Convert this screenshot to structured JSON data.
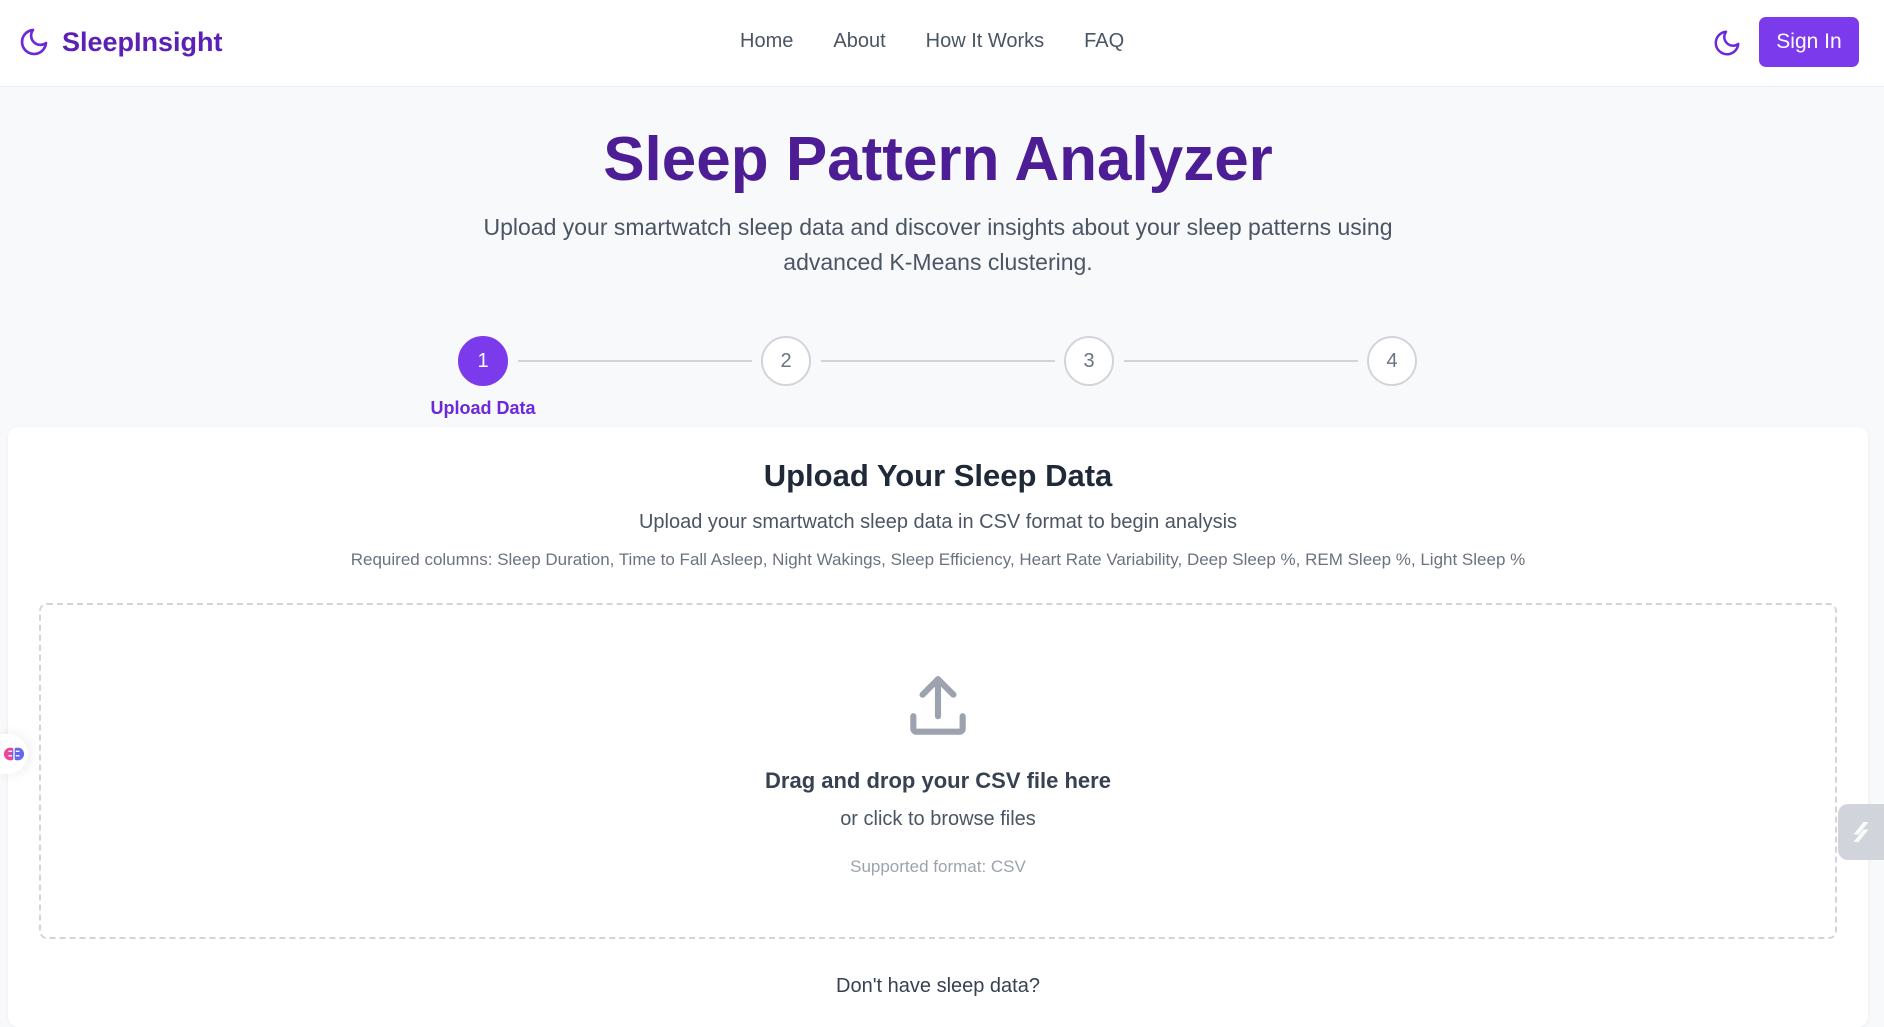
{
  "brand": {
    "name": "SleepInsight",
    "icon": "moon-icon",
    "color": "#5b21b6"
  },
  "nav": {
    "links": [
      "Home",
      "About",
      "How It Works",
      "FAQ"
    ],
    "theme_toggle_icon": "moon-icon",
    "signin_label": "Sign In"
  },
  "hero": {
    "title": "Sleep Pattern Analyzer",
    "subtitle": "Upload your smartwatch sleep data and discover insights about your sleep patterns using advanced K-Means clustering."
  },
  "stepper": {
    "steps": [
      "1",
      "2",
      "3",
      "4"
    ],
    "active_index": 0,
    "active_label": "Upload Data"
  },
  "upload": {
    "title": "Upload Your Sleep Data",
    "subtitle": "Upload your smartwatch sleep data in CSV format to begin analysis",
    "required": "Required columns: Sleep Duration, Time to Fall Asleep, Night Wakings, Sleep Efficiency, Heart Rate Variability, Deep Sleep %, REM Sleep %, Light Sleep %",
    "dropzone": {
      "icon": "upload-icon",
      "main_text": "Drag and drop your CSV file here",
      "sub_text": "or click to browse files",
      "format_text": "Supported format: CSV"
    },
    "no_data_text": "Don't have sleep data?"
  },
  "colors": {
    "accent": "#7c3aed",
    "title": "#4c1d95"
  }
}
